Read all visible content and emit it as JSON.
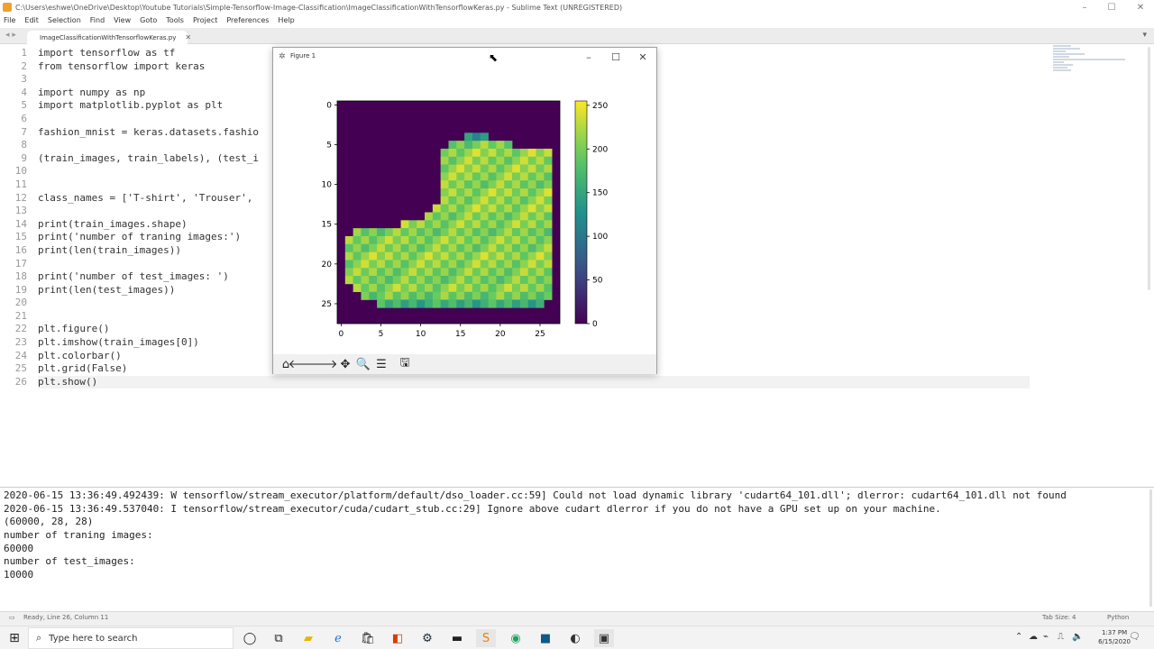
{
  "window": {
    "title": "C:\\Users\\eshwe\\OneDrive\\Desktop\\Youtube Tutorials\\Simple-Tensorflow-Image-Classification\\ImageClassificationWithTensorflowKeras.py - Sublime Text (UNREGISTERED)",
    "minimize": "–",
    "maximize": "☐",
    "close": "✕"
  },
  "menu": [
    "File",
    "Edit",
    "Selection",
    "Find",
    "View",
    "Goto",
    "Tools",
    "Project",
    "Preferences",
    "Help"
  ],
  "tab": {
    "nav": "◂ ▸",
    "label": "ImageClassificationWithTensorflowKeras.py",
    "close": "✕",
    "dropdown": "▾"
  },
  "editor": {
    "line_numbers": [
      "1",
      "2",
      "3",
      "4",
      "5",
      "6",
      "7",
      "8",
      "9",
      "10",
      "11",
      "12",
      "13",
      "14",
      "15",
      "16",
      "17",
      "18",
      "19",
      "20",
      "21",
      "22",
      "23",
      "24",
      "25",
      "26"
    ],
    "lines": [
      "import tensorflow as tf",
      "from tensorflow import keras",
      "",
      "import numpy as np",
      "import matplotlib.pyplot as plt",
      "",
      "fashion_mnist = keras.datasets.fashio",
      "",
      "(train_images, train_labels), (test_i",
      "",
      "",
      "class_names = ['T-shirt', 'Trouser',                                                 nd', 'Ankle Boot']",
      "",
      "print(train_images.shape)",
      "print('number of traning images:')",
      "print(len(train_images))",
      "",
      "print('number of test_images: ')",
      "print(len(test_images))",
      "",
      "",
      "plt.figure()",
      "plt.imshow(train_images[0])",
      "plt.colorbar()",
      "plt.grid(False)",
      "plt.show()"
    ]
  },
  "console": [
    "2020-06-15 13:36:49.492439: W tensorflow/stream_executor/platform/default/dso_loader.cc:59] Could not load dynamic library 'cudart64_101.dll'; dlerror: cudart64_101.dll not found",
    "2020-06-15 13:36:49.537040: I tensorflow/stream_executor/cuda/cudart_stub.cc:29] Ignore above cudart dlerror if you do not have a GPU set up on your machine.",
    "(60000, 28, 28)",
    "number of traning images:",
    "60000",
    "number of test_images:",
    "10000"
  ],
  "statusbar": {
    "left": "Ready, Line 26, Column 11",
    "tab_size": "Tab Size: 4",
    "syntax": "Python"
  },
  "figure": {
    "title": "Figure 1",
    "minimize": "–",
    "maximize": "☐",
    "close": "✕",
    "toolbar": {
      "home": "⌂",
      "back": "🡐",
      "forward": "🡒",
      "pan": "✥",
      "zoom": "🔍",
      "configure": "☰",
      "save": "🖫"
    }
  },
  "chart_data": {
    "type": "heatmap",
    "title": "",
    "xlabel": "",
    "ylabel": "",
    "xticks": [
      0,
      5,
      10,
      15,
      20,
      25
    ],
    "yticks": [
      0,
      5,
      10,
      15,
      20,
      25
    ],
    "xlim": [
      -0.5,
      27.5
    ],
    "ylim": [
      27.5,
      -0.5
    ],
    "grid": false,
    "colormap": "viridis",
    "colorbar": {
      "min": 0,
      "max": 255,
      "ticks": [
        0,
        50,
        100,
        150,
        200,
        250
      ]
    },
    "description": "28x28 grayscale image (ankle boot) from Fashion-MNIST training set, index 0; rows listed as [start_col, end_col, intensity] spans",
    "rows": [
      [],
      [],
      [],
      [],
      [
        [
          16,
          18,
          140
        ]
      ],
      [
        [
          14,
          21,
          200
        ]
      ],
      [
        [
          13,
          26,
          215
        ]
      ],
      [
        [
          13,
          26,
          210
        ]
      ],
      [
        [
          13,
          26,
          215
        ]
      ],
      [
        [
          13,
          26,
          210
        ]
      ],
      [
        [
          13,
          26,
          205
        ]
      ],
      [
        [
          13,
          26,
          215
        ]
      ],
      [
        [
          13,
          26,
          210
        ]
      ],
      [
        [
          12,
          26,
          215
        ]
      ],
      [
        [
          11,
          26,
          205
        ]
      ],
      [
        [
          8,
          26,
          210
        ]
      ],
      [
        [
          2,
          26,
          200
        ]
      ],
      [
        [
          1,
          26,
          210
        ]
      ],
      [
        [
          1,
          26,
          205
        ]
      ],
      [
        [
          1,
          26,
          215
        ]
      ],
      [
        [
          1,
          26,
          210
        ]
      ],
      [
        [
          1,
          26,
          205
        ]
      ],
      [
        [
          1,
          26,
          200
        ]
      ],
      [
        [
          2,
          26,
          210
        ]
      ],
      [
        [
          3,
          26,
          195
        ]
      ],
      [
        [
          5,
          25,
          160
        ]
      ],
      [],
      []
    ]
  },
  "taskbar": {
    "start": "⊞",
    "search_icon": "⌕",
    "search_placeholder": "Type here to search",
    "time": "1:37 PM",
    "date": "6/15/2020"
  }
}
